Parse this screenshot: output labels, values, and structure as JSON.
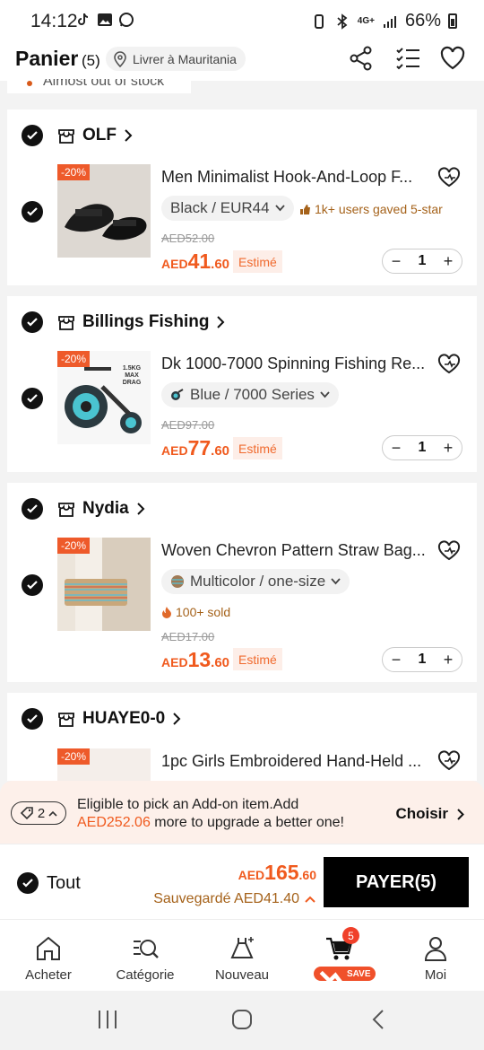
{
  "status_bar": {
    "time": "14:12",
    "battery": "66%",
    "network": "4G+"
  },
  "header": {
    "title": "Panier",
    "count": "(5)",
    "location": "Livrer à Mauritania",
    "icons": [
      "share-icon",
      "list-check-icon",
      "heart-icon"
    ]
  },
  "partial_notice": "Almost out of stock",
  "cards": [
    {
      "store": "OLF",
      "discount": "-20%",
      "title": "Men Minimalist Hook-And-Loop F...",
      "variant": "Black / EUR44",
      "social": "1k+ users gaved 5-star",
      "old_price": "AED52.00",
      "price_currency": "AED",
      "price_int": "41",
      "price_dec": ".60",
      "estimate": "Estimé",
      "qty": "1"
    },
    {
      "store": "Billings Fishing",
      "discount": "-20%",
      "title": "Dk 1000-7000 Spinning Fishing Re...",
      "variant": "Blue / 7000 Series",
      "old_price": "AED97.00",
      "price_currency": "AED",
      "price_int": "77",
      "price_dec": ".60",
      "estimate": "Estimé",
      "qty": "1",
      "image_label": "1.5KG MAX DRAG"
    },
    {
      "store": "Nydia",
      "discount": "-20%",
      "title": "Woven Chevron Pattern Straw Bag...",
      "variant": "Multicolor / one-size",
      "social": "100+ sold",
      "old_price": "AED17.00",
      "price_currency": "AED",
      "price_int": "13",
      "price_dec": ".60",
      "estimate": "Estimé",
      "qty": "1"
    },
    {
      "store": "HUAYE0-0",
      "discount": "-20%",
      "title": "1pc Girls Embroidered Hand-Held ..."
    }
  ],
  "addon": {
    "coupon_count": "2",
    "line1": "Eligible to pick an Add-on item.Add",
    "amount": "AED252.06",
    "line2_rest": " more to upgrade a better one!",
    "action": "Choisir"
  },
  "checkout": {
    "select_all": "Tout",
    "total_currency": "AED",
    "total_int": "165",
    "total_dec": ".60",
    "saved": "Sauvegardé AED41.40",
    "pay": "PAYER(5)"
  },
  "tabs": [
    {
      "label": "Acheter",
      "icon": "home-icon"
    },
    {
      "label": "Catégorie",
      "icon": "category-search-icon"
    },
    {
      "label": "Nouveau",
      "icon": "new-dress-icon"
    },
    {
      "label": "",
      "icon": "cart-icon",
      "badge": "5",
      "save": "SAVE"
    },
    {
      "label": "Moi",
      "icon": "person-icon"
    }
  ],
  "colors": {
    "accent": "#f05a1e",
    "primary": "#000000",
    "social": "#a5621a"
  }
}
